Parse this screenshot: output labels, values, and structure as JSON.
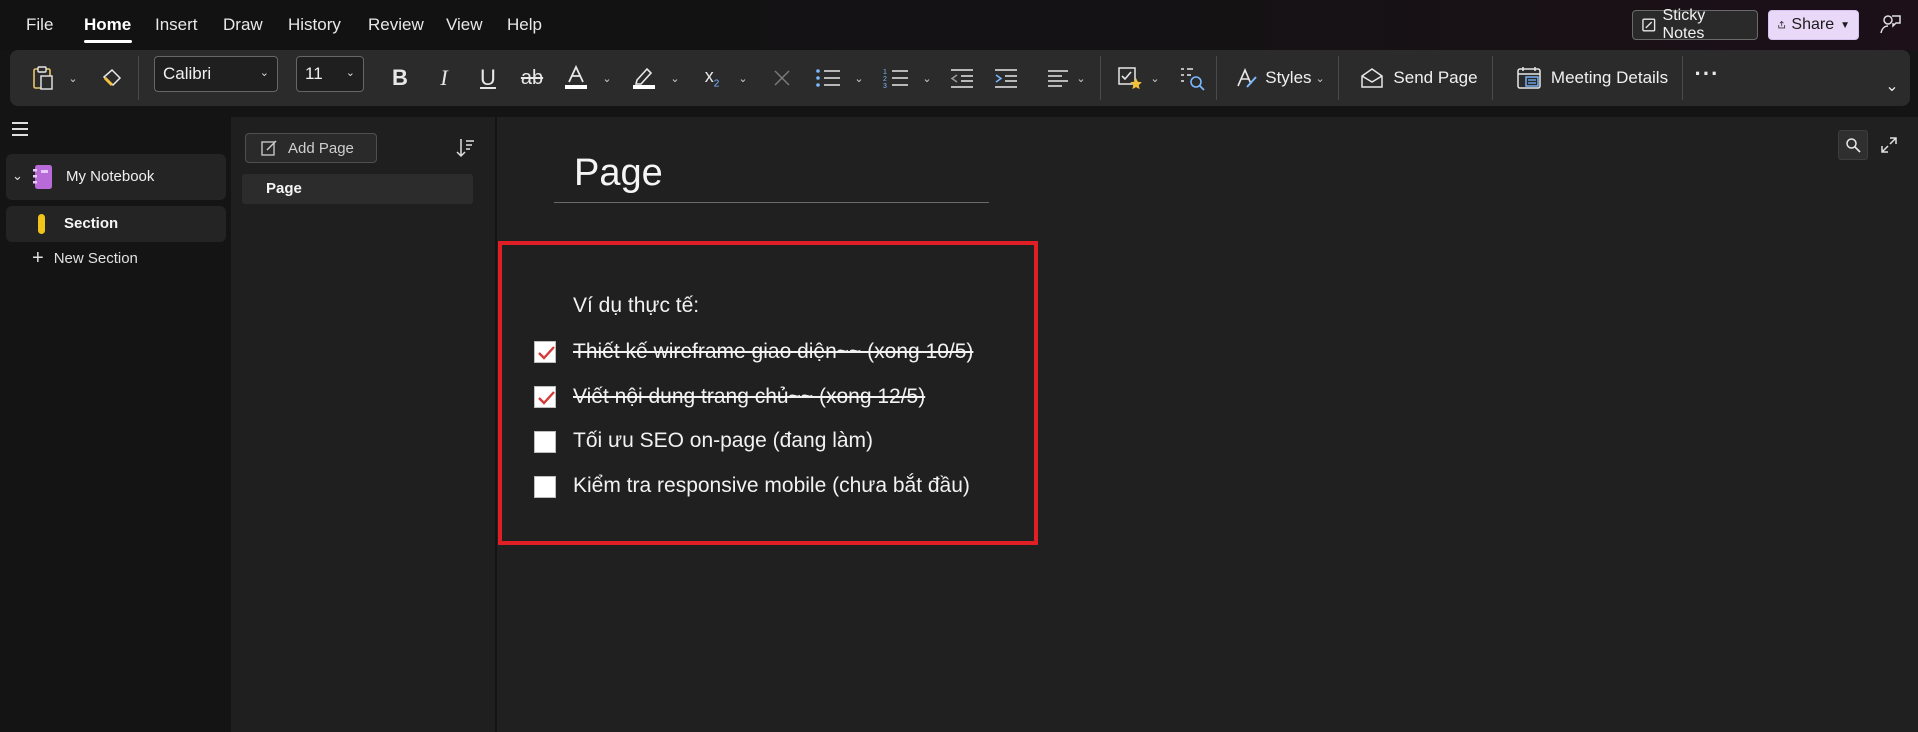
{
  "menu": {
    "items": [
      "File",
      "Home",
      "Insert",
      "Draw",
      "History",
      "Review",
      "View",
      "Help"
    ],
    "active": "Home",
    "sticky_notes": "Sticky Notes",
    "share": "Share"
  },
  "ribbon": {
    "font_name": "Calibri",
    "font_size": "11",
    "styles_label": "Styles",
    "send_page_label": "Send Page",
    "meeting_details_label": "Meeting Details",
    "more_label": "···"
  },
  "nav": {
    "notebook": "My Notebook",
    "section": "Section",
    "new_section": "New Section"
  },
  "pages": {
    "add_page": "Add Page",
    "items": [
      "Page"
    ]
  },
  "page": {
    "title": "Page",
    "intro": "Ví dụ thực tế:",
    "todos": [
      {
        "text": "Thiết kế wireframe giao diện~~ (xong 10/5)",
        "checked": true
      },
      {
        "text": "Viết nội dung trang chủ~~ (xong 12/5)",
        "checked": true
      },
      {
        "text": "Tối ưu SEO on-page (đang làm)",
        "checked": false
      },
      {
        "text": "Kiểm tra responsive mobile (chưa bắt đầu)",
        "checked": false
      }
    ]
  },
  "colors": {
    "highlight": "#e01e25",
    "notebook_icon": "#b86ad8",
    "section_tab": "#f0c419",
    "check": "#d63a3a",
    "share_bg": "#e9d8f8"
  }
}
